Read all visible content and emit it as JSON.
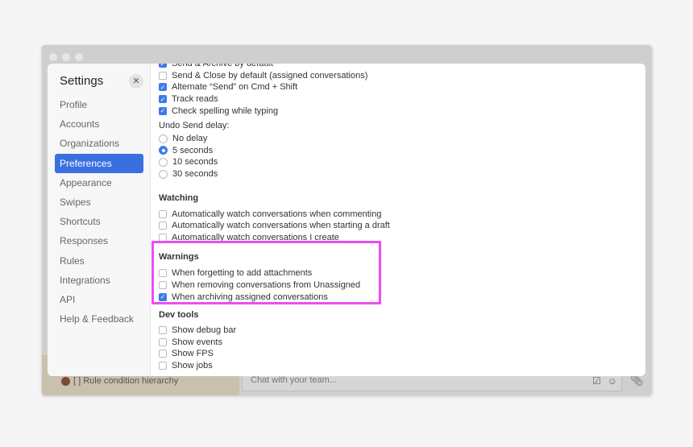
{
  "background": {
    "bottom_item": "[ ] Rule condition hierarchy",
    "chat_placeholder": "Chat with your team..."
  },
  "settings": {
    "title": "Settings",
    "nav": [
      "Profile",
      "Accounts",
      "Organizations",
      "Preferences",
      "Appearance",
      "Swipes",
      "Shortcuts",
      "Responses",
      "Rules",
      "Integrations",
      "API",
      "Help & Feedback"
    ],
    "active": "Preferences",
    "top_items": [
      {
        "label": "Send & Archive by default",
        "checked": true
      },
      {
        "label": "Send & Close by default (assigned conversations)",
        "checked": false
      },
      {
        "label": "Alternate “Send” on Cmd + Shift",
        "checked": true
      },
      {
        "label": "Track reads",
        "checked": true
      },
      {
        "label": "Check spelling while typing",
        "checked": true
      }
    ],
    "undo_label": "Undo Send delay:",
    "undo_options": [
      {
        "label": "No delay",
        "selected": false
      },
      {
        "label": "5 seconds",
        "selected": true
      },
      {
        "label": "10 seconds",
        "selected": false
      },
      {
        "label": "30 seconds",
        "selected": false
      }
    ],
    "sections": [
      {
        "title": "Watching",
        "items": [
          {
            "label": "Automatically watch conversations when commenting",
            "checked": false
          },
          {
            "label": "Automatically watch conversations when starting a draft",
            "checked": false
          },
          {
            "label": "Automatically watch conversations I create",
            "checked": false
          }
        ]
      },
      {
        "title": "Warnings",
        "items": [
          {
            "label": "When forgetting to add attachments",
            "checked": false
          },
          {
            "label": "When removing conversations from Unassigned",
            "checked": false
          },
          {
            "label": "When archiving assigned conversations",
            "checked": true
          }
        ]
      },
      {
        "title": "Dev tools",
        "items": [
          {
            "label": "Show debug bar",
            "checked": false
          },
          {
            "label": "Show events",
            "checked": false
          },
          {
            "label": "Show FPS",
            "checked": false
          },
          {
            "label": "Show jobs",
            "checked": false
          }
        ]
      }
    ]
  },
  "colors": {
    "accent": "#3a6fe0",
    "highlight": "#e94ff0"
  }
}
